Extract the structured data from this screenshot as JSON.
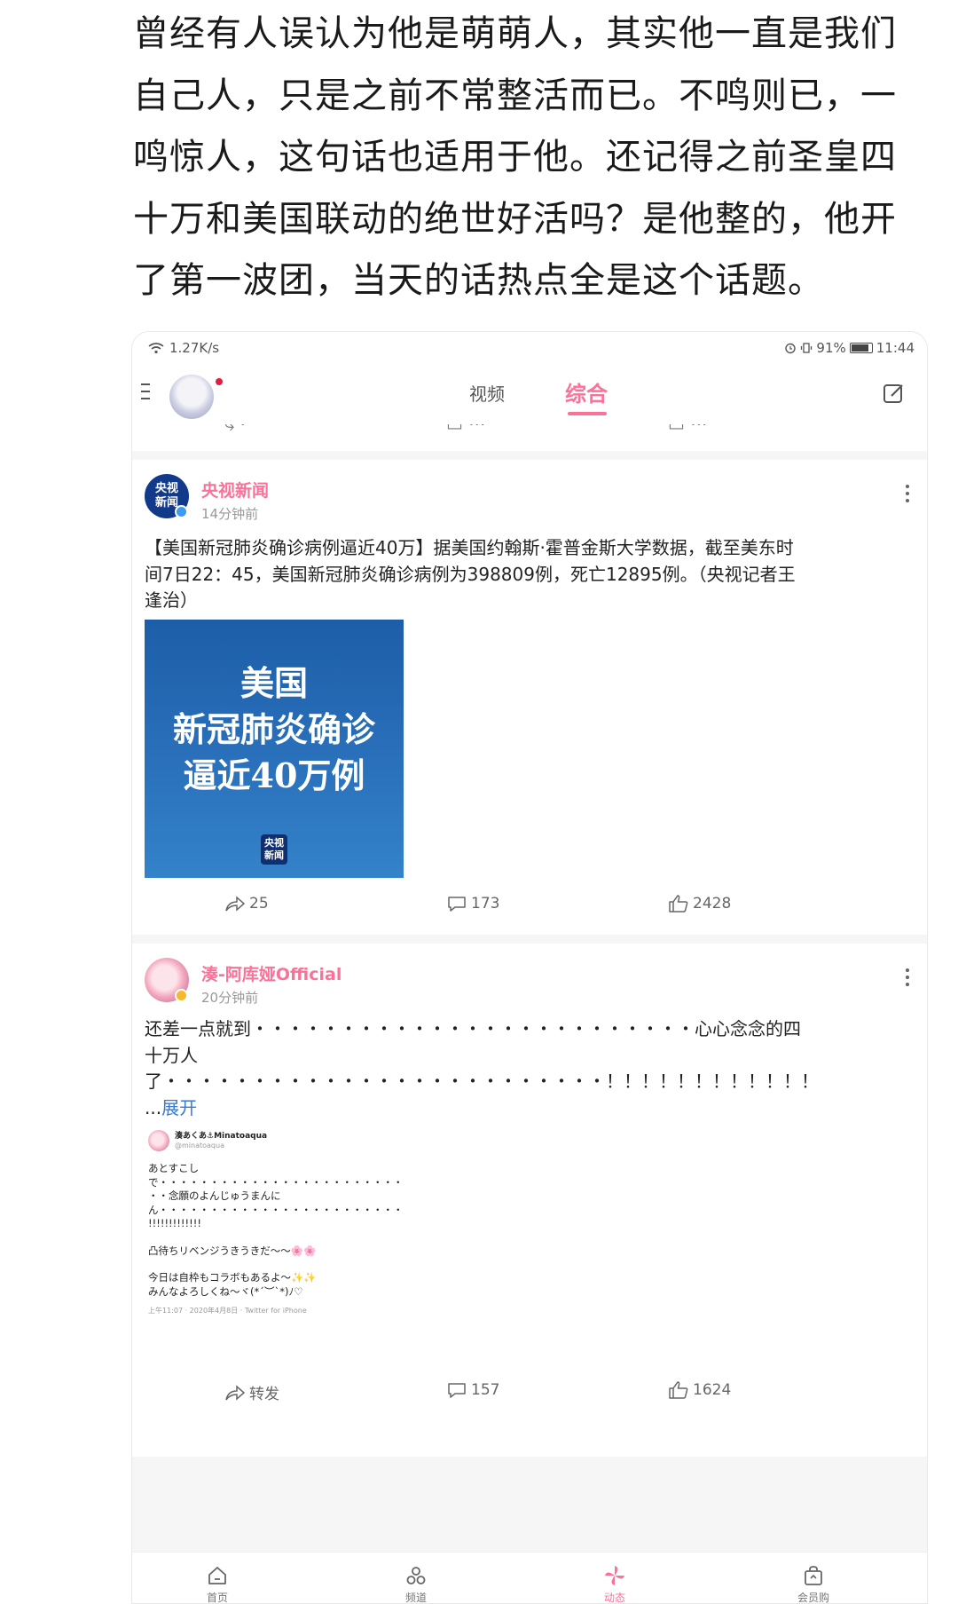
{
  "article": {
    "text": "曾经有人误认为他是萌萌人，其实他一直是我们自己人，只是之前不常整活而已。不鸣则已，一鸣惊人，这句话也适用于他。还记得之前圣皇四十万和美国联动的绝世好活吗？是他整的，他开了第一波团，当天的话热点全是这个话题。"
  },
  "statusbar": {
    "speed": "1.27K/s",
    "battery": "91%",
    "time": "11:44"
  },
  "topbar": {
    "tabs": [
      "视频",
      "综合"
    ],
    "active_tab": "综合",
    "accent_color": "#fb7299"
  },
  "posts": [
    {
      "author": "央视新闻",
      "avatar_text": [
        "央视",
        "新闻"
      ],
      "time": "14分钟前",
      "content": "【美国新冠肺炎确诊病例逼近40万】据美国约翰斯·霍普金斯大学数据，截至美东时间7日22：45，美国新冠肺炎确诊病例为398809例，死亡12895例。（央视记者王逢治）",
      "image_lines": [
        "美国",
        "新冠肺炎确诊",
        "逼近40万例"
      ],
      "image_logo": [
        "央视",
        "新闻"
      ],
      "actions": {
        "share": "25",
        "comment": "173",
        "like": "2428"
      }
    },
    {
      "author": "湊-阿库娅Official",
      "time": "20分钟前",
      "content": "还差一点就到・・・・・・・・・・・・・・・・・・・・・・・・・心心念念的四十万人了・・・・・・・・・・・・・・・・・・・・・・・・・！！！！！！！！！！！！ ...",
      "expand": "展开",
      "tweet": {
        "name": "湊あくあ⚓Minatoaqua",
        "handle": "@minatoaqua",
        "lines": [
          "あとすこし",
          "で・・・・・・・・・・・・・・・・・・・・・・・・",
          "・・念願のよんじゅうまんに",
          "ん・・・・・・・・・・・・・・・・・・・・・・・・",
          "!!!!!!!!!!!!!",
          "",
          "凸待ちリベンジうきうきだ〜〜🌸🌸",
          "",
          "今日は自枠もコラボもあるよ〜✨✨",
          "みんなよろしくね〜ヾ(*´︶`*)ﾉ♡"
        ],
        "footer": "上午11:07 · 2020年4月8日 · Twitter for iPhone"
      },
      "actions": {
        "share": "转发",
        "comment": "157",
        "like": "1624"
      }
    }
  ],
  "bottomnav": {
    "items": [
      "首页",
      "频道",
      "动态",
      "会员购"
    ],
    "active": "动态"
  }
}
